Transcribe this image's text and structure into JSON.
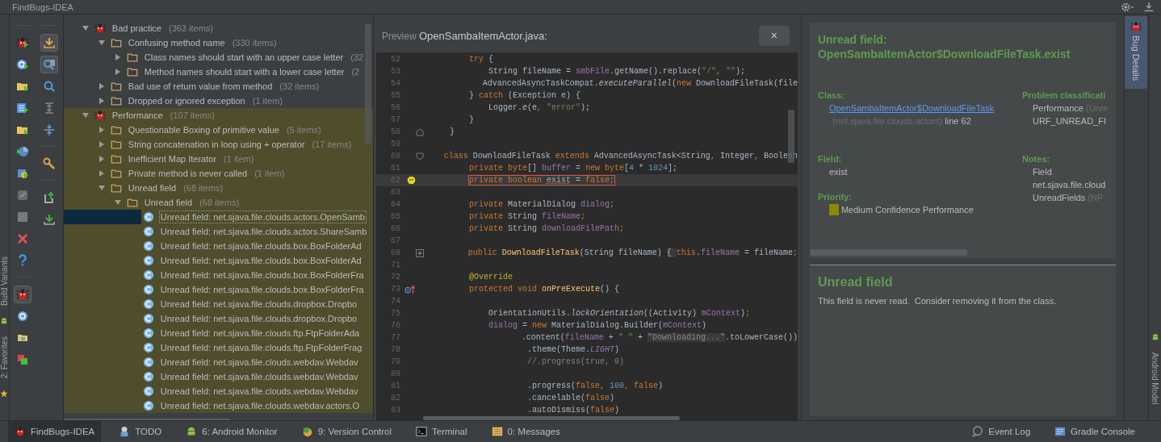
{
  "window": {
    "title": "FindBugs-IDEA"
  },
  "left_edge_tabs": [
    {
      "label": "Build Variants",
      "kind": "android"
    },
    {
      "label": "2: Favorites",
      "kind": "star"
    }
  ],
  "right_edge_tabs": [
    {
      "label": "Android Model",
      "kind": "android"
    }
  ],
  "toolbar_main": [
    {
      "kind": "separator"
    },
    {
      "kind": "bug-run",
      "selected": false
    },
    {
      "kind": "circle-run",
      "selected": false
    },
    {
      "kind": "folder-run",
      "selected": false
    },
    {
      "kind": "grid-run",
      "selected": false
    },
    {
      "kind": "folder-run",
      "selected": false
    },
    {
      "kind": "pie",
      "selected": false
    },
    {
      "kind": "changes-run",
      "selected": false
    },
    {
      "kind": "check",
      "selected": false
    },
    {
      "kind": "stop",
      "selected": false
    },
    {
      "kind": "close",
      "selected": false
    },
    {
      "kind": "help",
      "selected": false
    },
    {
      "kind": "separator"
    },
    {
      "kind": "bug",
      "selected": true
    },
    {
      "kind": "circle",
      "selected": false
    },
    {
      "kind": "folder",
      "selected": false
    },
    {
      "kind": "squares",
      "selected": false
    }
  ],
  "toolbar_view": [
    {
      "kind": "separator"
    },
    {
      "kind": "import",
      "selected": true
    },
    {
      "kind": "search-box",
      "selected": true
    },
    {
      "kind": "search",
      "selected": false
    },
    {
      "kind": "expand",
      "selected": false
    },
    {
      "kind": "collapse",
      "selected": false
    },
    {
      "kind": "separator"
    },
    {
      "kind": "wrench",
      "selected": false
    },
    {
      "kind": "separator"
    },
    {
      "kind": "export",
      "selected": false
    },
    {
      "kind": "import-green",
      "selected": false
    }
  ],
  "tree": [
    {
      "label": "Bad practice",
      "count": "(363 items)",
      "kind": "group",
      "expanded": true,
      "highlighted": false,
      "children": [
        {
          "label": "Confusing method name",
          "count": "(330 items)",
          "kind": "folder",
          "expanded": true,
          "children": [
            {
              "label": "Class names should start with an upper case letter",
              "count": "(32",
              "kind": "folder",
              "expanded": false
            },
            {
              "label": "Method names should start with a lower case letter",
              "count": "(2",
              "kind": "folder",
              "expanded": false
            }
          ]
        },
        {
          "label": "Bad use of return value from method",
          "count": "(32 items)",
          "kind": "folder",
          "expanded": false
        },
        {
          "label": "Dropped or ignored exception",
          "count": "(1 item)",
          "kind": "folder",
          "expanded": false
        }
      ]
    },
    {
      "label": "Performance",
      "count": "(107 items)",
      "kind": "group",
      "expanded": true,
      "highlighted": true,
      "children": [
        {
          "label": "Questionable Boxing of primitive value",
          "count": "(5 items)",
          "kind": "folder",
          "expanded": false
        },
        {
          "label": "String concatenation in loop using + operator",
          "count": "(17 items)",
          "kind": "folder",
          "expanded": false
        },
        {
          "label": "Inefficient Map Iterator",
          "count": "(1 item)",
          "kind": "folder",
          "expanded": false
        },
        {
          "label": "Private method is never called",
          "count": "(1 item)",
          "kind": "folder",
          "expanded": false
        },
        {
          "label": "Unread field",
          "count": "(68 items)",
          "kind": "folder",
          "expanded": true,
          "children": [
            {
              "label": "Unread field",
              "count": "(68 items)",
              "kind": "folder",
              "expanded": true,
              "children": [
                {
                  "label": "Unread field: net.sjava.file.clouds.actors.OpenSamb",
                  "kind": "instance",
                  "selected": true
                },
                {
                  "label": "Unread field: net.sjava.file.clouds.actors.ShareSamb",
                  "kind": "instance",
                  "selected": false
                },
                {
                  "label": "Unread field: net.sjava.file.clouds.box.BoxFolderAd",
                  "kind": "instance",
                  "selected": false
                },
                {
                  "label": "Unread field: net.sjava.file.clouds.box.BoxFolderAd",
                  "kind": "instance",
                  "selected": false
                },
                {
                  "label": "Unread field: net.sjava.file.clouds.box.BoxFolderFra",
                  "kind": "instance",
                  "selected": false
                },
                {
                  "label": "Unread field: net.sjava.file.clouds.box.BoxFolderFra",
                  "kind": "instance",
                  "selected": false
                },
                {
                  "label": "Unread field: net.sjava.file.clouds.dropbox.Dropbo",
                  "kind": "instance",
                  "selected": false
                },
                {
                  "label": "Unread field: net.sjava.file.clouds.dropbox.Dropbo",
                  "kind": "instance",
                  "selected": false
                },
                {
                  "label": "Unread field: net.sjava.file.clouds.ftp.FtpFolderAda",
                  "kind": "instance",
                  "selected": false
                },
                {
                  "label": "Unread field: net.sjava.file.clouds.ftp.FtpFolderFrag",
                  "kind": "instance",
                  "selected": false
                },
                {
                  "label": "Unread field: net.sjava.file.clouds.webdav.Webdav",
                  "kind": "instance",
                  "selected": false
                },
                {
                  "label": "Unread field: net.sjava.file.clouds.webdav.Webdav",
                  "kind": "instance",
                  "selected": false
                },
                {
                  "label": "Unread field: net.sjava.file.clouds.webdav.Webdav",
                  "kind": "instance",
                  "selected": false
                },
                {
                  "label": "Unread field: net.sjava.file.clouds.webdav.actors.O",
                  "kind": "instance",
                  "selected": false
                }
              ]
            }
          ]
        }
      ]
    }
  ],
  "preview": {
    "prefix": "Preview",
    "file": "OpenSambaItemActor.java:",
    "close": "×",
    "lines": [
      {
        "number": "52",
        "flagged": false,
        "indent": {
          "kind": "level-2"
        },
        "segments": [
          {
            "kind": "kw",
            "text": "try"
          },
          {
            "kind": "p",
            "text": " {"
          }
        ]
      },
      {
        "number": "53",
        "flagged": false,
        "indent": {
          "kind": "level-3"
        },
        "segments": [
          {
            "kind": "p",
            "text": "String fileName = "
          },
          {
            "kind": "fd",
            "text": "smbFile"
          },
          {
            "kind": "p",
            "text": ".getName().replace("
          },
          {
            "kind": "s",
            "text": "\"/\""
          },
          {
            "kind": "kw",
            "text": ", "
          },
          {
            "kind": "s",
            "text": "\"\""
          },
          {
            "kind": "p",
            "text": ");"
          }
        ]
      },
      {
        "number": "54",
        "flagged": false,
        "indent": {
          "kind": "level-3"
        },
        "segments": [
          {
            "kind": "p",
            "text": "AdvancedAsyncTaskCompat."
          },
          {
            "kind": "it",
            "text": "executeParallel"
          },
          {
            "kind": "p",
            "text": "("
          },
          {
            "kind": "kw",
            "text": "new "
          },
          {
            "kind": "p",
            "text": "DownloadFileTask(file"
          }
        ]
      },
      {
        "number": "55",
        "flagged": false,
        "indent": {
          "kind": "level-2"
        },
        "segments": [
          {
            "kind": "p",
            "text": "} "
          },
          {
            "kind": "kw",
            "text": "catch "
          },
          {
            "kind": "p",
            "text": "(Exception e) {"
          }
        ]
      },
      {
        "number": "56",
        "flagged": false,
        "indent": {
          "kind": "level-3"
        },
        "segments": [
          {
            "kind": "p",
            "text": "Logger."
          },
          {
            "kind": "it",
            "text": "e"
          },
          {
            "kind": "p",
            "text": "(e"
          },
          {
            "kind": "kw",
            "text": ", "
          },
          {
            "kind": "s",
            "text": "\"error\""
          },
          {
            "kind": "p",
            "text": ");"
          }
        ]
      },
      {
        "number": "57",
        "flagged": false,
        "indent": {
          "kind": "level-2"
        },
        "segments": [
          {
            "kind": "p",
            "text": "}"
          }
        ]
      },
      {
        "number": "58",
        "flagged": false,
        "gutter": {
          "kind": "fold-end"
        },
        "indent": {
          "kind": "level-1"
        },
        "segments": [
          {
            "kind": "p",
            "text": "}"
          }
        ]
      },
      {
        "number": "59",
        "flagged": false
      },
      {
        "number": "60",
        "flagged": false,
        "gutter": {
          "kind": "fold-start"
        },
        "indent": {
          "kind": "level-1"
        },
        "segments": [
          {
            "kind": "kw",
            "text": "class "
          },
          {
            "kind": "p",
            "text": "DownloadFileTask "
          },
          {
            "kind": "kw",
            "text": "extends "
          },
          {
            "kind": "p",
            "text": "AdvancedAsyncTask<String"
          },
          {
            "kind": "kw",
            "text": ", "
          },
          {
            "kind": "p",
            "text": "Integer"
          },
          {
            "kind": "kw",
            "text": ", "
          },
          {
            "kind": "p",
            "text": "Boolean"
          }
        ]
      },
      {
        "number": "61",
        "flagged": false,
        "indent": {
          "kind": "level-2"
        },
        "segments": [
          {
            "kind": "kw",
            "text": "private byte"
          },
          {
            "kind": "p",
            "text": "[] "
          },
          {
            "kind": "fd",
            "text": "buffer"
          },
          {
            "kind": "p",
            "text": " = "
          },
          {
            "kind": "kw",
            "text": "new byte"
          },
          {
            "kind": "p",
            "text": "["
          },
          {
            "kind": "n",
            "text": "4"
          },
          {
            "kind": "p",
            "text": " * "
          },
          {
            "kind": "n",
            "text": "1024"
          },
          {
            "kind": "p",
            "text": "];"
          }
        ]
      },
      {
        "number": "62",
        "flagged": true,
        "gutter": {
          "kind": "bug"
        },
        "indent": {
          "kind": "level-2"
        },
        "segments": [
          {
            "kind": "kw",
            "text": "private boolean "
          },
          {
            "kind": "u",
            "text": "exist"
          },
          {
            "kind": "p",
            "text": " = "
          },
          {
            "kind": "kw",
            "text": "false;"
          }
        ]
      },
      {
        "number": "63",
        "flagged": false
      },
      {
        "number": "64",
        "flagged": false,
        "indent": {
          "kind": "level-2"
        },
        "segments": [
          {
            "kind": "kw",
            "text": "private "
          },
          {
            "kind": "p",
            "text": "MaterialDialog "
          },
          {
            "kind": "fd",
            "text": "dialog"
          },
          {
            "kind": "kw",
            "text": ";"
          }
        ]
      },
      {
        "number": "65",
        "flagged": false,
        "indent": {
          "kind": "level-2"
        },
        "segments": [
          {
            "kind": "kw",
            "text": "private "
          },
          {
            "kind": "p",
            "text": "String "
          },
          {
            "kind": "fd",
            "text": "fileName"
          },
          {
            "kind": "kw",
            "text": ";"
          }
        ]
      },
      {
        "number": "66",
        "flagged": false,
        "indent": {
          "kind": "level-2"
        },
        "segments": [
          {
            "kind": "kw",
            "text": "private "
          },
          {
            "kind": "p",
            "text": "String "
          },
          {
            "kind": "fd",
            "text": "downloadFilePath"
          },
          {
            "kind": "kw",
            "text": ";"
          }
        ]
      },
      {
        "number": "67",
        "flagged": false
      },
      {
        "number": "68",
        "flagged": false,
        "gutter": {
          "kind": "fold-plus"
        },
        "indent": {
          "kind": "level-2"
        },
        "segments": [
          {
            "kind": "kw",
            "text": "public "
          },
          {
            "kind": "md",
            "text": "DownloadFileTask"
          },
          {
            "kind": "p",
            "text": "(String fileName) "
          },
          {
            "kind": "fold",
            "text": "{ "
          },
          {
            "kind": "kw",
            "text": "this"
          },
          {
            "kind": "p",
            "text": "."
          },
          {
            "kind": "fd",
            "text": "fileName"
          },
          {
            "kind": "p",
            "text": " = fileName"
          },
          {
            "kind": "kw",
            "text": ";"
          }
        ]
      },
      {
        "number": "71",
        "flagged": false
      },
      {
        "number": "72",
        "flagged": false,
        "indent": {
          "kind": "level-2"
        },
        "segments": [
          {
            "kind": "an",
            "text": "@Override"
          }
        ]
      },
      {
        "number": "73",
        "flagged": false,
        "gutter": {
          "kind": "override"
        },
        "indent": {
          "kind": "level-2"
        },
        "segments": [
          {
            "kind": "kw",
            "text": "protected void "
          },
          {
            "kind": "md",
            "text": "onPreExecute"
          },
          {
            "kind": "p",
            "text": "() {"
          }
        ]
      },
      {
        "number": "74",
        "flagged": false
      },
      {
        "number": "75",
        "flagged": false,
        "indent": {
          "kind": "level-3"
        },
        "segments": [
          {
            "kind": "p",
            "text": "OrientationUtils."
          },
          {
            "kind": "it",
            "text": "lockOrientation"
          },
          {
            "kind": "p",
            "text": "((Activity) "
          },
          {
            "kind": "fd",
            "text": "mContext"
          },
          {
            "kind": "p",
            "text": ")"
          },
          {
            "kind": "kw",
            "text": ";"
          }
        ]
      },
      {
        "number": "76",
        "flagged": false,
        "indent": {
          "kind": "level-3"
        },
        "segments": [
          {
            "kind": "fd",
            "text": "dialog"
          },
          {
            "kind": "p",
            "text": " = "
          },
          {
            "kind": "kw",
            "text": "new "
          },
          {
            "kind": "p",
            "text": "MaterialDialog.Builder("
          },
          {
            "kind": "fd",
            "text": "mContext"
          },
          {
            "kind": "p",
            "text": ")"
          }
        ]
      },
      {
        "number": "77",
        "flagged": false,
        "indent": {
          "kind": "continuation"
        },
        "segments": [
          {
            "kind": "p",
            "text": ".content("
          },
          {
            "kind": "fd",
            "text": "fileName"
          },
          {
            "kind": "p",
            "text": " + "
          },
          {
            "kind": "s",
            "text": "\" \""
          },
          {
            "kind": "p",
            "text": " + "
          },
          {
            "kind": "sh",
            "text": "\"Downloading...\""
          },
          {
            "kind": "p",
            "text": ".toLowerCase())"
          }
        ]
      },
      {
        "number": "78",
        "flagged": false,
        "indent": {
          "kind": "continuation"
        },
        "segments": [
          {
            "kind": "p",
            "text": ".theme(Theme."
          },
          {
            "kind": "ci",
            "text": "LIGHT"
          },
          {
            "kind": "p",
            "text": ")"
          }
        ]
      },
      {
        "number": "79",
        "flagged": false,
        "indent": {
          "kind": "continuation"
        },
        "segments": [
          {
            "kind": "c",
            "text": "//.progress(true, 0)"
          }
        ]
      },
      {
        "number": "80",
        "flagged": false
      },
      {
        "number": "81",
        "flagged": false,
        "indent": {
          "kind": "continuation"
        },
        "segments": [
          {
            "kind": "p",
            "text": ".progress("
          },
          {
            "kind": "kw",
            "text": "false, "
          },
          {
            "kind": "n",
            "text": "100"
          },
          {
            "kind": "kw",
            "text": ", false"
          },
          {
            "kind": "p",
            "text": ")"
          }
        ]
      },
      {
        "number": "82",
        "flagged": false,
        "indent": {
          "kind": "continuation"
        },
        "segments": [
          {
            "kind": "p",
            "text": ".cancelable("
          },
          {
            "kind": "kw",
            "text": "false"
          },
          {
            "kind": "p",
            "text": ")"
          }
        ]
      },
      {
        "number": "83",
        "flagged": false,
        "indent": {
          "kind": "continuation"
        },
        "segments": [
          {
            "kind": "p",
            "text": ".autoDismiss("
          },
          {
            "kind": "kw",
            "text": "false"
          },
          {
            "kind": "p",
            "text": ")"
          }
        ]
      }
    ]
  },
  "details": {
    "title": "Unread field: OpenSambaItemActor$DownloadFileTask.exist",
    "class_section": {
      "label": "Class:",
      "link": "OpenSambaItemActor$DownloadFileTask",
      "package": "(net.sjava.file.clouds.actors)",
      "line": "line 62"
    },
    "classification": {
      "label": "Problem classificati",
      "lines": [
        {
          "text": "Performance",
          "note": "(Unre"
        },
        {
          "text": "URF_UNREAD_FI"
        }
      ]
    },
    "field": {
      "label": "Field:",
      "value": "exist"
    },
    "notes": {
      "label": "Notes:",
      "lines": [
        {
          "text": "Field"
        },
        {
          "text": "net.sjava.file.cloud"
        },
        {
          "text": "UnreadFields",
          "note": "(NP"
        }
      ]
    },
    "priority": {
      "label": "Priority:",
      "text": "Medium Confidence Performance",
      "color": "#8b8b00"
    },
    "pattern": {
      "title": "Unread field",
      "description": "This field is never read.  Consider removing it from the class."
    }
  },
  "side_tab": {
    "label": "Bug Details",
    "selected": true
  },
  "bottom_tabs": [
    {
      "label": "FindBugs-IDEA",
      "kind": "bug",
      "selected": true
    },
    {
      "label": "TODO",
      "kind": "todo",
      "selected": false
    },
    {
      "label": "6: Android Monitor",
      "kind": "android",
      "selected": false
    },
    {
      "label": "9: Version Control",
      "kind": "vcs",
      "selected": false
    },
    {
      "label": "Terminal",
      "kind": "terminal",
      "selected": false
    },
    {
      "label": "0: Messages",
      "kind": "messages",
      "selected": false
    }
  ],
  "bottom_right": [
    {
      "label": "Event Log",
      "kind": "balloon"
    },
    {
      "label": "Gradle Console",
      "kind": "console"
    }
  ]
}
